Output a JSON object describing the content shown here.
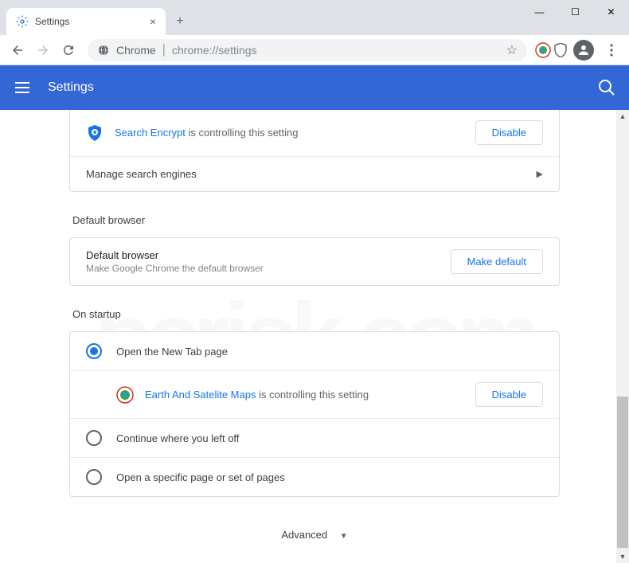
{
  "window": {
    "tab_title": "Settings",
    "close": "×",
    "new_tab": "+",
    "min": "—",
    "max": "☐",
    "x": "✕"
  },
  "toolbar": {
    "omnibox_prefix": "Chrome",
    "omnibox_url": "chrome://settings",
    "star": "☆"
  },
  "header": {
    "title": "Settings"
  },
  "search_engine_card": {
    "ext_name": "Search Encrypt",
    "ctrl_text": " is controlling this setting",
    "disable_btn": "Disable",
    "manage_label": "Manage search engines"
  },
  "default_browser": {
    "section": "Default browser",
    "title": "Default browser",
    "subtitle": "Make Google Chrome the default browser",
    "btn": "Make default"
  },
  "startup": {
    "section": "On startup",
    "opt1": "Open the New Tab page",
    "ext_name": "Earth And Satelite Maps",
    "ctrl_text": " is controlling this setting",
    "disable_btn": "Disable",
    "opt2": "Continue where you left off",
    "opt3": "Open a specific page or set of pages"
  },
  "advanced": {
    "label": "Advanced",
    "chevron": "▼"
  }
}
